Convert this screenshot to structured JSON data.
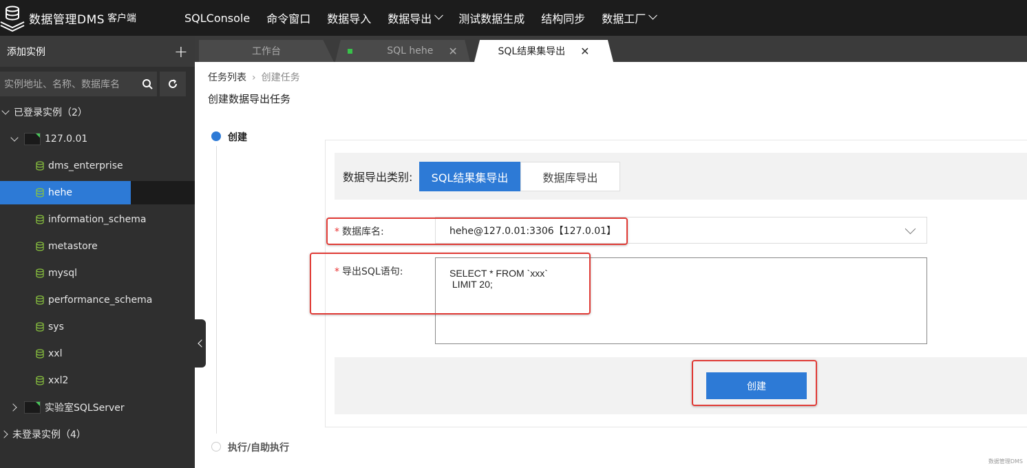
{
  "app": {
    "title": "数据管理DMS",
    "subtitle": "客户端"
  },
  "nav": [
    {
      "label": "SQLConsole",
      "has_dropdown": false
    },
    {
      "label": "命令窗口",
      "has_dropdown": false
    },
    {
      "label": "数据导入",
      "has_dropdown": false
    },
    {
      "label": "数据导出",
      "has_dropdown": true
    },
    {
      "label": "测试数据生成",
      "has_dropdown": false
    },
    {
      "label": "结构同步",
      "has_dropdown": false
    },
    {
      "label": "数据工厂",
      "has_dropdown": true
    }
  ],
  "sidebar": {
    "add_instance": "添加实例",
    "search_placeholder": "实例地址、名称、数据库名",
    "logged_in_group": "已登录实例（2）",
    "instance1": "127.0.01",
    "databases": [
      "dms_enterprise",
      "hehe",
      "information_schema",
      "metastore",
      "mysql",
      "performance_schema",
      "sys",
      "xxl",
      "xxl2"
    ],
    "selected_db": "hehe",
    "instance2": "实验室SQLServer",
    "logged_out_group": "未登录实例（4）"
  },
  "tabs": [
    {
      "label": "工作台",
      "active": false
    },
    {
      "label": "SQL hehe",
      "active": false
    },
    {
      "label": "SQL结果集导出",
      "active": true
    }
  ],
  "breadcrumb": {
    "root": "任务列表",
    "current": "创建任务"
  },
  "page_title": "创建数据导出任务",
  "steps": [
    "创建",
    "执行/自助执行"
  ],
  "form": {
    "export_type_label": "数据导出类别:",
    "export_type_options": [
      "SQL结果集导出",
      "数据库导出"
    ],
    "export_type_selected": "SQL结果集导出",
    "db_label": "数据库名:",
    "db_value": "hehe@127.0.01:3306【127.0.01】",
    "sql_label": "导出SQL语句:",
    "sql_value": "SELECT * FROM `xxx`\n LIMIT 20;",
    "create_label": "创建"
  },
  "watermark": "数据管理DMS",
  "colors": {
    "accent": "#2d7ad6",
    "highlight": "#e03a35",
    "topbar": "#1c1c1c",
    "sidebar": "#2f2f2f"
  }
}
